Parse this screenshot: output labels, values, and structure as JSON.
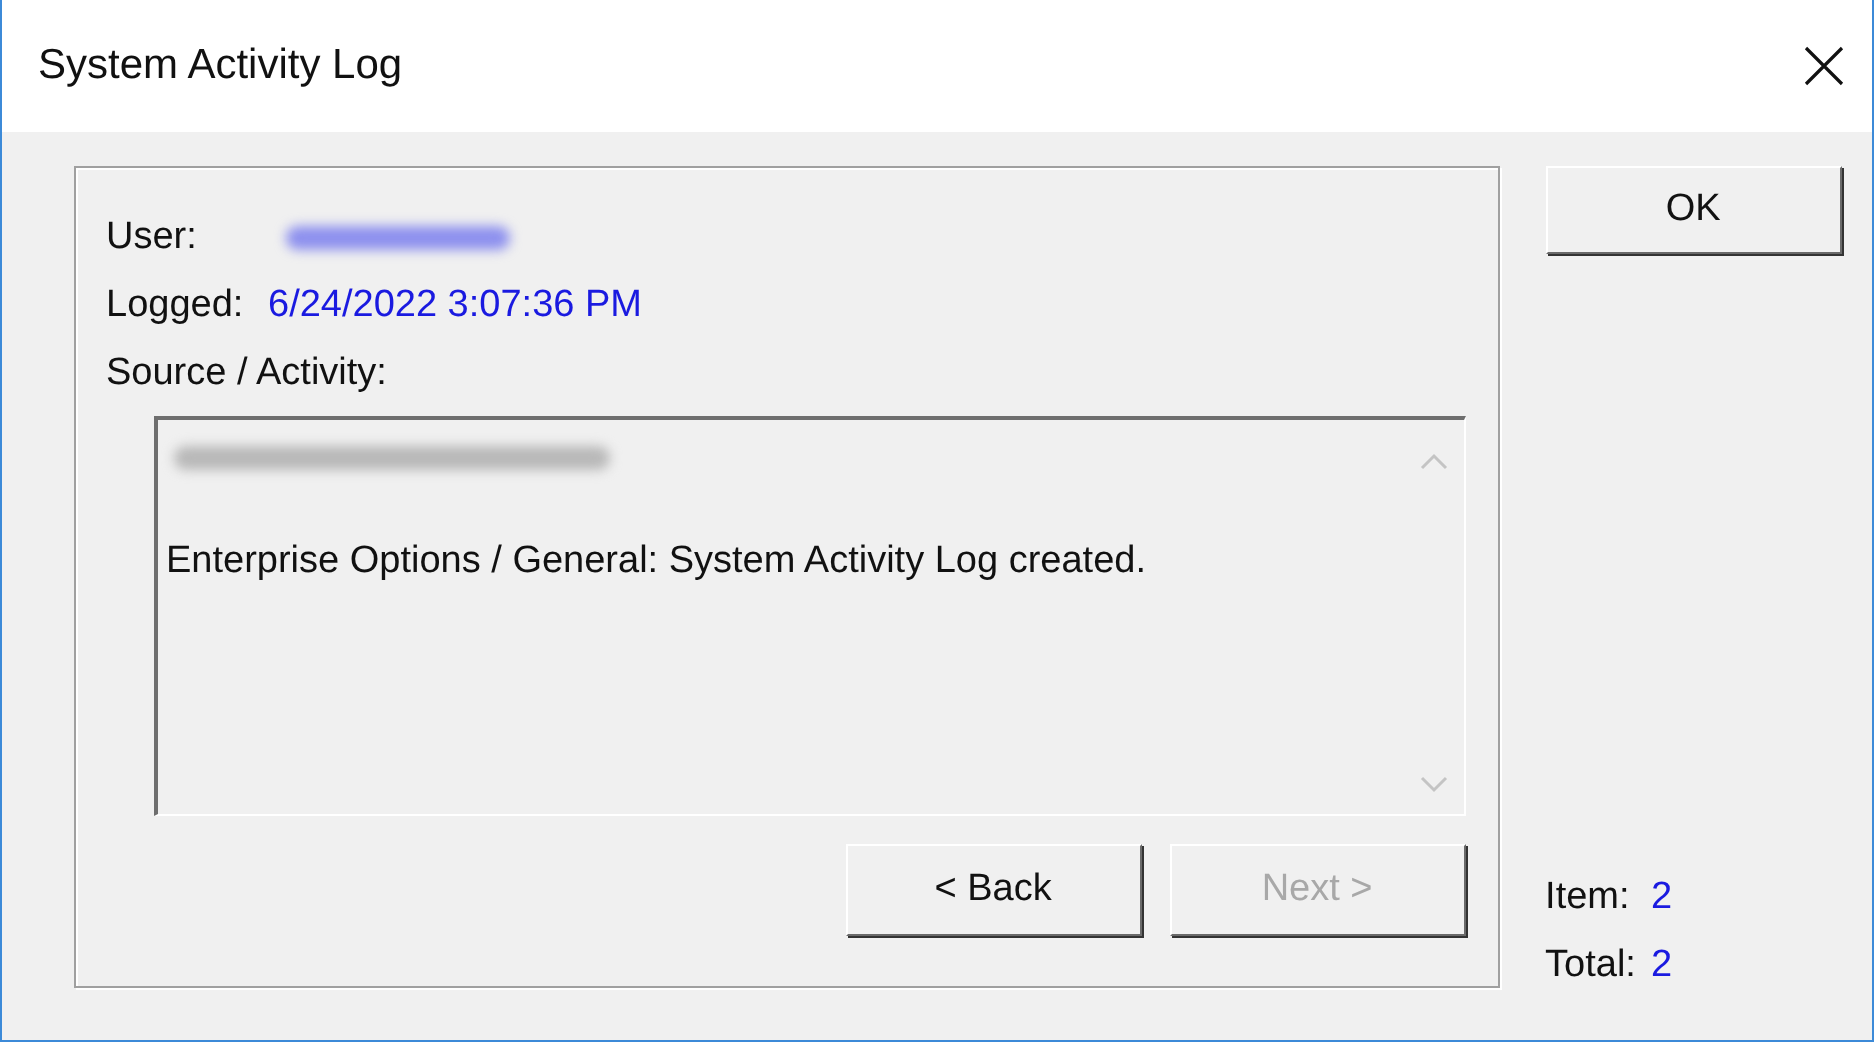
{
  "window": {
    "title": "System Activity Log"
  },
  "fields": [
    {
      "label": "User:",
      "kind": "redacted"
    },
    {
      "label": "Logged:",
      "kind": "text",
      "value": "6/24/2022 3:07:36 PM"
    }
  ],
  "activity": {
    "label": "Source / Activity:",
    "lines": [
      {
        "kind": "redacted"
      },
      {
        "kind": "text",
        "text": "Enterprise Options / General: System Activity Log created."
      }
    ]
  },
  "buttons": [
    {
      "label": "< Back",
      "disabled": false
    },
    {
      "label": "Next >",
      "disabled": true
    }
  ],
  "ok_button": "OK",
  "counters": [
    {
      "label": "Item:",
      "value": "2"
    },
    {
      "label": "Total:",
      "value": "2"
    }
  ]
}
